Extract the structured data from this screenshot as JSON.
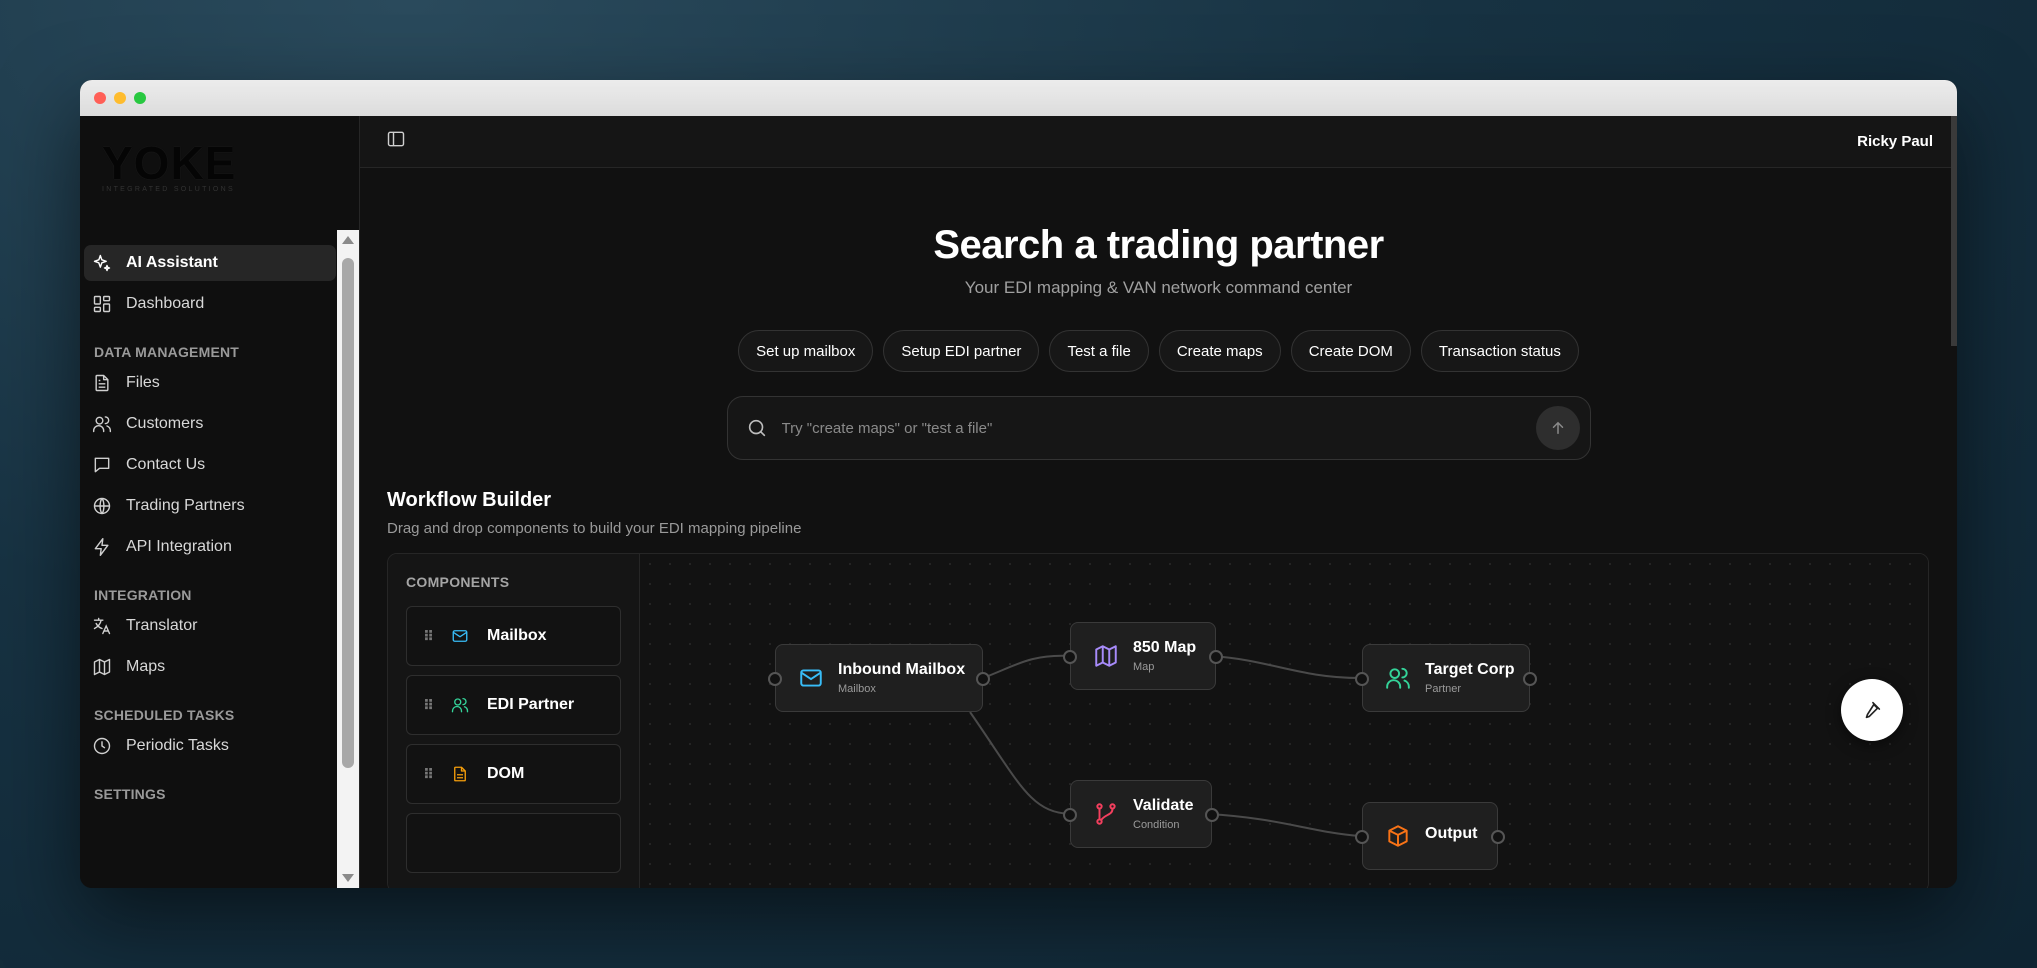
{
  "window": {
    "controls": [
      "close",
      "minimize",
      "zoom"
    ]
  },
  "logo": {
    "word": "YOKE",
    "tagline": "INTEGRATED SOLUTIONS"
  },
  "sidebar": {
    "top_items": [
      {
        "label": "AI Assistant",
        "icon": "sparkles-icon",
        "active": true
      },
      {
        "label": "Dashboard",
        "icon": "dashboard-icon"
      }
    ],
    "sections": [
      {
        "title": "DATA MANAGEMENT",
        "items": [
          {
            "label": "Files",
            "icon": "file-icon"
          },
          {
            "label": "Customers",
            "icon": "users-icon"
          },
          {
            "label": "Contact Us",
            "icon": "message-icon"
          },
          {
            "label": "Trading Partners",
            "icon": "globe-icon"
          },
          {
            "label": "API Integration",
            "icon": "lightning-icon"
          }
        ]
      },
      {
        "title": "INTEGRATION",
        "items": [
          {
            "label": "Translator",
            "icon": "translate-icon"
          },
          {
            "label": "Maps",
            "icon": "map-icon"
          }
        ]
      },
      {
        "title": "SCHEDULED TASKS",
        "items": [
          {
            "label": "Periodic Tasks",
            "icon": "clock-icon"
          }
        ]
      },
      {
        "title": "SETTINGS",
        "items": []
      }
    ]
  },
  "topbar": {
    "toggle_icon": "sidebar-toggle-icon",
    "user_name": "Ricky Paul"
  },
  "hero": {
    "title": "Search a trading partner",
    "subtitle": "Your EDI mapping & VAN network command center",
    "chips": [
      "Set up mailbox",
      "Setup EDI partner",
      "Test a file",
      "Create maps",
      "Create DOM",
      "Transaction status"
    ],
    "search_placeholder": "Try \"create maps\" or \"test a file\""
  },
  "workflow": {
    "title": "Workflow Builder",
    "subtitle": "Drag and drop components to build your EDI mapping pipeline",
    "components_title": "COMPONENTS",
    "components": [
      {
        "label": "Mailbox",
        "icon": "mail-icon",
        "color": "#38bdf8"
      },
      {
        "label": "EDI Partner",
        "icon": "users-icon",
        "color": "#34d399"
      },
      {
        "label": "DOM",
        "icon": "file-icon",
        "color": "#f59e0b"
      }
    ],
    "nodes": [
      {
        "id": "inbound",
        "title": "Inbound Mailbox",
        "subtitle": "Mailbox",
        "icon": "mail-icon",
        "color": "#38bdf8"
      },
      {
        "id": "map850",
        "title": "850 Map",
        "subtitle": "Map",
        "icon": "map-icon",
        "color": "#a78bfa"
      },
      {
        "id": "target",
        "title": "Target Corp",
        "subtitle": "Partner",
        "icon": "users-icon",
        "color": "#34d399"
      },
      {
        "id": "validate",
        "title": "Validate",
        "subtitle": "Condition",
        "icon": "branch-icon",
        "color": "#f43f5e"
      },
      {
        "id": "output",
        "title": "Output",
        "subtitle": "",
        "icon": "box-icon",
        "color": "#f97316"
      }
    ]
  },
  "fab": {
    "icon": "hammer-icon"
  }
}
